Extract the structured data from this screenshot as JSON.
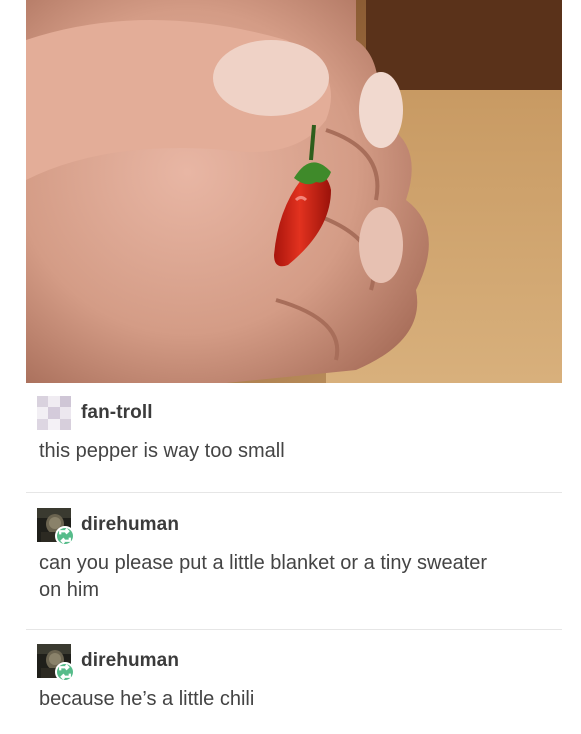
{
  "posts": [
    {
      "username": "fan-troll",
      "text": "this pepper is way too small",
      "avatar_icon": "pixelated-avatar-icon",
      "reblogged": false
    },
    {
      "username": "direhuman",
      "text": "can you please put a little blanket or a tiny sweater on him",
      "avatar_icon": "dark-portrait-avatar-icon",
      "reblogged": true
    },
    {
      "username": "direhuman",
      "text": "because he’s a little chili",
      "avatar_icon": "dark-portrait-avatar-icon",
      "reblogged": true
    }
  ],
  "colors": {
    "reblog_badge": "#56bc8a",
    "pepper_red": "#d8291c",
    "pepper_stem": "#3f8a2a",
    "username_text": "#3b3b3b",
    "body_text": "#444444"
  }
}
